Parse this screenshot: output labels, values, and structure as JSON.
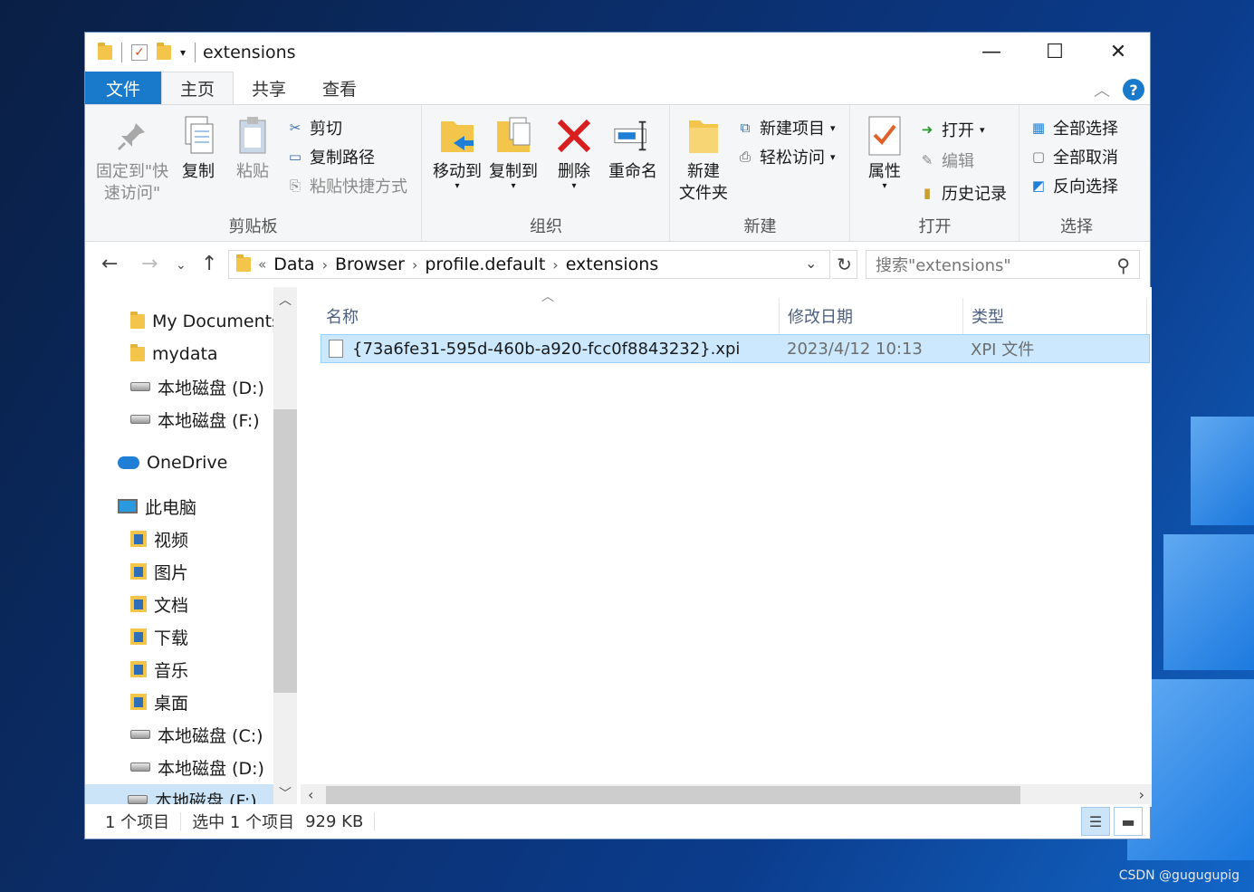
{
  "window": {
    "title": "extensions"
  },
  "ribbon_tabs": [
    "文件",
    "主页",
    "共享",
    "查看"
  ],
  "ribbon": {
    "clipboard": {
      "label": "剪贴板",
      "pin": "固定到\"快\n速访问\"",
      "copy": "复制",
      "paste": "粘贴",
      "cut": "剪切",
      "copy_path": "复制路径",
      "paste_shortcut": "粘贴快捷方式"
    },
    "organize": {
      "label": "组织",
      "move_to": "移动到",
      "copy_to": "复制到",
      "delete": "删除",
      "rename": "重命名"
    },
    "new": {
      "label": "新建",
      "new_folder": "新建\n文件夹",
      "new_item": "新建项目",
      "easy_access": "轻松访问"
    },
    "open": {
      "label": "打开",
      "properties": "属性",
      "open": "打开",
      "edit": "编辑",
      "history": "历史记录"
    },
    "select": {
      "label": "选择",
      "select_all": "全部选择",
      "select_none": "全部取消",
      "invert": "反向选择"
    }
  },
  "address": {
    "overflow": "«",
    "crumbs": [
      "Data",
      "Browser",
      "profile.default",
      "extensions"
    ],
    "search_placeholder": "搜索\"extensions\""
  },
  "nav": [
    {
      "label": "My Documents",
      "icon": "folder-icon"
    },
    {
      "label": "mydata",
      "icon": "folder-icon"
    },
    {
      "label": "本地磁盘 (D:)",
      "icon": "drive-icon"
    },
    {
      "label": "本地磁盘 (F:)",
      "icon": "drive-icon"
    },
    {
      "label": "OneDrive",
      "icon": "cloud-icon"
    },
    {
      "label": "此电脑",
      "icon": "pc-icon"
    },
    {
      "label": "视频",
      "icon": "video-folder-icon"
    },
    {
      "label": "图片",
      "icon": "pictures-folder-icon"
    },
    {
      "label": "文档",
      "icon": "documents-folder-icon"
    },
    {
      "label": "下载",
      "icon": "downloads-folder-icon"
    },
    {
      "label": "音乐",
      "icon": "music-folder-icon"
    },
    {
      "label": "桌面",
      "icon": "desktop-folder-icon"
    },
    {
      "label": "本地磁盘 (C:)",
      "icon": "system-drive-icon"
    },
    {
      "label": "本地磁盘 (D:)",
      "icon": "drive-icon"
    },
    {
      "label": "本地磁盘 (F:)",
      "icon": "drive-icon"
    }
  ],
  "columns": {
    "name": "名称",
    "modified": "修改日期",
    "type": "类型"
  },
  "files": [
    {
      "name": "{73a6fe31-595d-460b-a920-fcc0f8843232}.xpi",
      "modified": "2023/4/12 10:13",
      "type": "XPI 文件"
    }
  ],
  "status": {
    "count": "1 个项目",
    "selected": "选中 1 个项目",
    "size": "929 KB"
  },
  "watermark": "CSDN @gugugupig",
  "colors": {
    "accent": "#1979ca",
    "selection": "#cce8ff"
  }
}
